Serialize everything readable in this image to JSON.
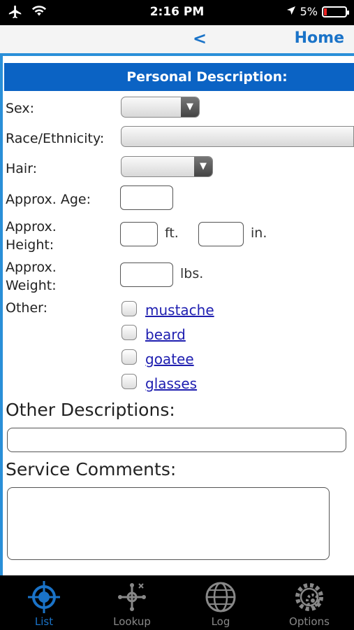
{
  "status": {
    "time": "2:16 PM",
    "battery": "5%"
  },
  "nav": {
    "back": "<",
    "home": "Home"
  },
  "section_title": "Personal Description:",
  "labels": {
    "sex": "Sex:",
    "race": "Race/Ethnicity:",
    "hair": "Hair:",
    "age": "Approx. Age:",
    "height_1": "Approx.",
    "height_2": "Height:",
    "weight_1": "Approx.",
    "weight_2": "Weight:",
    "other": "Other:"
  },
  "units": {
    "feet": "ft.",
    "inches": "in.",
    "pounds": "lbs."
  },
  "other_options": [
    "mustache",
    "beard",
    "goatee",
    "glasses"
  ],
  "other_descriptions": "Other Descriptions:",
  "service_comments": "Service Comments:",
  "tabs": [
    {
      "label": "List",
      "icon": "crosshair-icon",
      "active": true
    },
    {
      "label": "Lookup",
      "icon": "network-icon",
      "active": false
    },
    {
      "label": "Log",
      "icon": "globe-icon",
      "active": false
    },
    {
      "label": "Options",
      "icon": "gears-icon",
      "active": false
    }
  ],
  "colors": {
    "accent": "#1a73c8",
    "header": "#0b63c4",
    "link": "#1e1eb0",
    "battery_low": "#e22222"
  }
}
